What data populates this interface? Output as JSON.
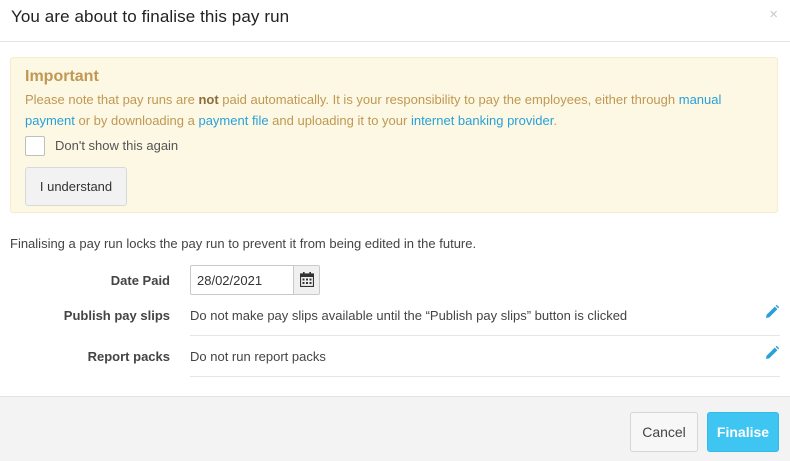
{
  "dialog": {
    "title": "You are about to finalise this pay run",
    "close_symbol": "×"
  },
  "alert": {
    "heading": "Important",
    "text_part1": "Please note that pay runs are ",
    "text_bold": "not",
    "text_part2": " paid automatically. It is your responsibility to pay the employees, either through ",
    "link_manual_payment": "manual payment",
    "text_part3": " or by downloading a ",
    "link_payment_file": "payment file",
    "text_part4": " and uploading it to your ",
    "link_internet_banking": "internet banking provider",
    "text_part5": ".",
    "checkbox_label": "Don't show this again",
    "checkbox_checked": false,
    "understand_button": "I understand"
  },
  "form": {
    "info_text": "Finalising a pay run locks the pay run to prevent it from being edited in the future.",
    "date_paid_label": "Date Paid",
    "date_paid_value": "28/02/2021",
    "publish_label": "Publish pay slips",
    "publish_value": "Do not make pay slips available until the “Publish pay slips” button is clicked",
    "report_label": "Report packs",
    "report_value": "Do not run report packs"
  },
  "footer": {
    "cancel_button": "Cancel",
    "finalise_button": "Finalise"
  },
  "icons": {
    "calendar": "calendar-icon",
    "edit": "pencil-icon",
    "close": "close-icon"
  },
  "colors": {
    "alert_background": "#fcf8e3",
    "alert_text": "#c09853",
    "link": "#2aa0d8",
    "primary_button": "#3ec5f1",
    "edit_icon": "#2aa0d8"
  }
}
